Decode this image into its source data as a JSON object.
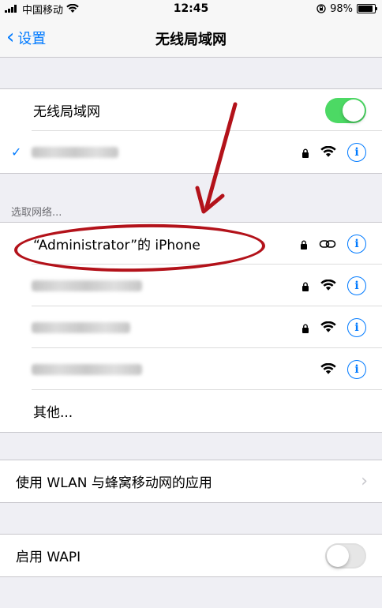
{
  "status_bar": {
    "carrier": "中国移动",
    "time": "12:45",
    "battery": "98%"
  },
  "nav": {
    "back_label": "设置",
    "title": "无线局域网"
  },
  "wifi": {
    "label": "无线局域网",
    "enabled": true,
    "connected_name": "(blurred)"
  },
  "choose_network_header": "选取网络...",
  "networks": [
    {
      "name": "“Administrator”的 iPhone",
      "secured": true,
      "icon": "hotspot-icon"
    },
    {
      "name": "(blurred)",
      "secured": true,
      "icon": "wifi-icon"
    },
    {
      "name": "(blurred)",
      "secured": true,
      "icon": "wifi-icon"
    },
    {
      "name": "(blurred)",
      "secured": false,
      "icon": "wifi-icon"
    }
  ],
  "other_label": "其他...",
  "apps_using_wlan": "使用 WLAN 与蜂窝移动网的应用",
  "wapi": {
    "label": "启用 WAPI",
    "enabled": false
  },
  "colors": {
    "accent": "#007aff",
    "toggle_on": "#4cd964",
    "annotation": "#b3121a"
  }
}
